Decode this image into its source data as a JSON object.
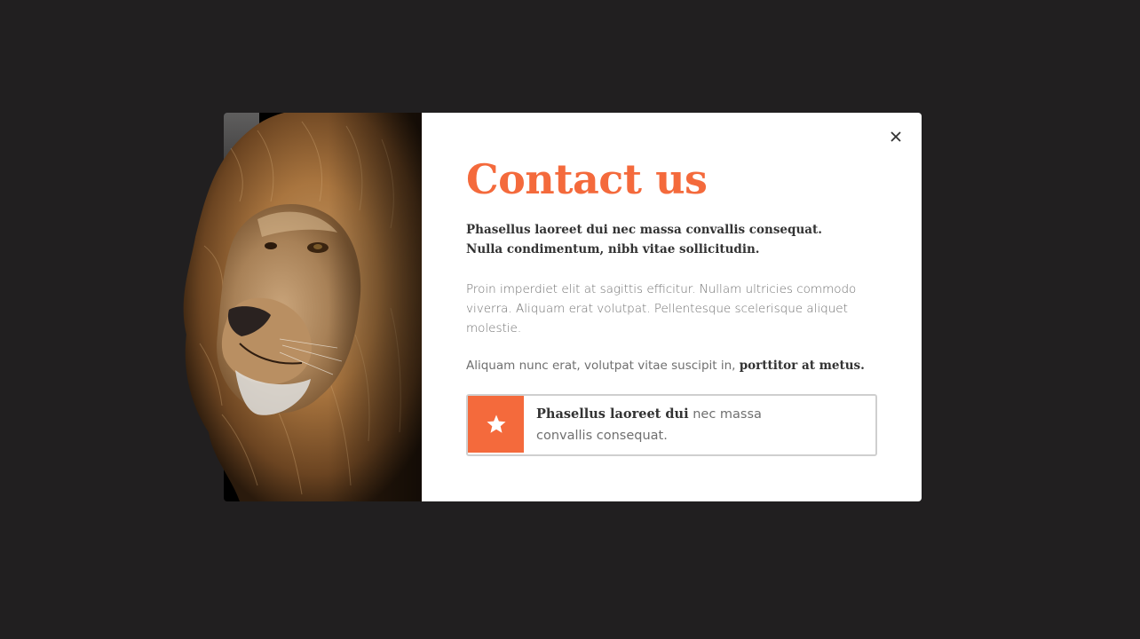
{
  "modal": {
    "title": "Contact us",
    "lead": "Phasellus laoreet dui nec massa convallis consequat. Nulla condimentum, nibh vitae sollicitudin.",
    "paragraph": "Proin imperdiet elit at sagittis efficitur. Nullam ultricies commodo viverra. Aliquam erat volutpat. Pellentesque scelerisque aliquet molestie.",
    "paragraph2_plain": "Aliquam nunc erat, volutpat vitae suscipit in, ",
    "paragraph2_bold": "porttitor at metus.",
    "feature": {
      "bold": "Phasellus laoreet dui",
      "plain_line1": " nec massa",
      "plain_line2": "convallis consequat.",
      "icon": "star-icon"
    },
    "close_icon": "close-icon",
    "image": "lion-photo"
  },
  "colors": {
    "accent": "#f46a3c",
    "backdrop": "#211f20",
    "panel": "#ffffff",
    "heading_text": "#333333",
    "body_text": "#6f6f6f"
  }
}
